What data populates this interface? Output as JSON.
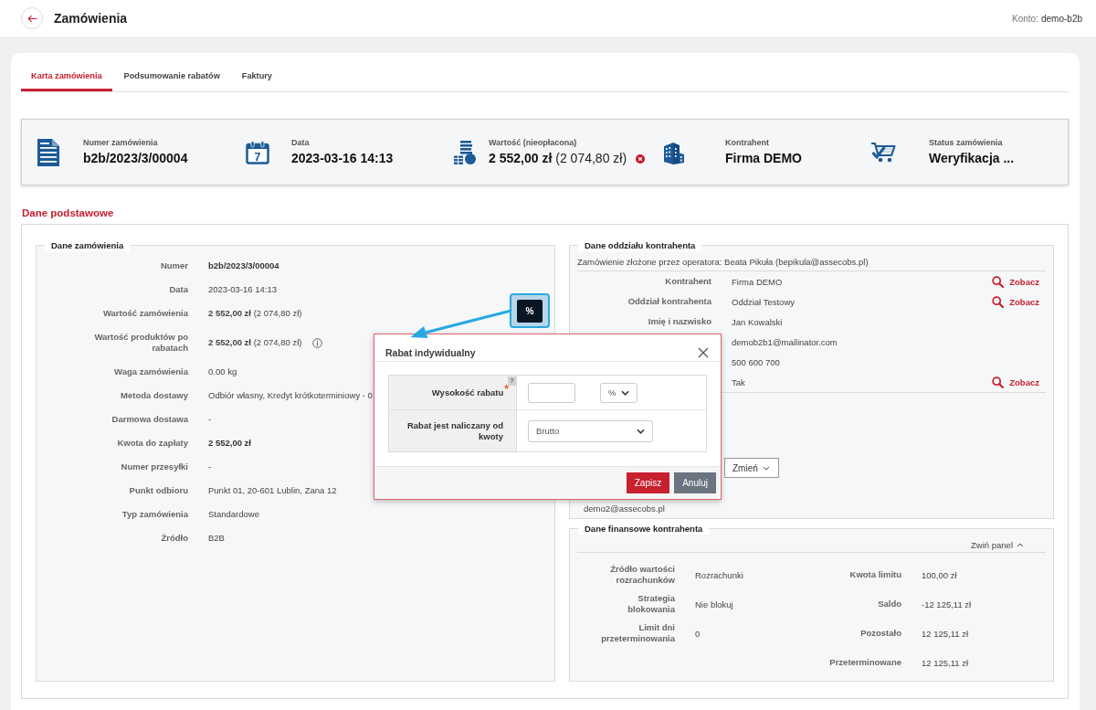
{
  "header": {
    "title": "Zamówienia",
    "account": {
      "label": "Konto:",
      "value": "demo-b2b"
    }
  },
  "tabs": [
    {
      "label": "Karta zamówienia",
      "selected": true
    },
    {
      "label": "Podsumowanie rabatów",
      "selected": false
    },
    {
      "label": "Faktury",
      "selected": false
    }
  ],
  "summary": [
    {
      "kind": "document",
      "label": "Numer zamówienia",
      "value": "b2b/2023/3/00004",
      "alert": false
    },
    {
      "kind": "calendar",
      "day": "7",
      "label": "Data",
      "value": "2023-03-16 14:13",
      "alert": false
    },
    {
      "kind": "coins",
      "label": "Wartość (nieopłacona)",
      "value": "2 552,00 zł",
      "note": "(2 074,80 zł)",
      "alert": true
    },
    {
      "kind": "building",
      "label": "Kontrahent",
      "value": "Firma DEMO",
      "alert": false
    },
    {
      "kind": "cart",
      "label": "Status zamówienia",
      "value": "Weryfikacja ...",
      "alert": false
    }
  ],
  "section_title": "Dane podstawowe",
  "order_panel": {
    "title": "Dane zamówienia",
    "rows": [
      {
        "label": "Numer",
        "value": "b2b/2023/3/00004",
        "bold": true,
        "info_icon": false
      },
      {
        "label": "Data",
        "value": "2023-03-16 14:13",
        "bold": false,
        "info_icon": false
      },
      {
        "label": "Wartość zamówienia",
        "value": "**2 552,00 zł** (2 074,80 zł)",
        "bold": false,
        "info_icon": false
      },
      {
        "label": "Wartość produktów po rabatach",
        "value": "**2 552,00 zł** (2 074,80 zł)",
        "bold": false,
        "info_icon": true
      },
      {
        "label": "Waga zamówienia",
        "value": "0.00 kg",
        "bold": false,
        "info_icon": false
      },
      {
        "label": "Metoda dostawy",
        "value": "Odbiór własny, Kredyt krótkoterminiowy - 0",
        "bold": false,
        "info_icon": false
      },
      {
        "label": "Darmowa dostawa",
        "value": "-",
        "bold": false,
        "info_icon": false
      },
      {
        "label": "Kwota do zapłaty",
        "value": "2 552,00 zł",
        "bold": true,
        "info_icon": false
      },
      {
        "label": "Numer przesyłki",
        "value": "-",
        "bold": false,
        "info_icon": false
      },
      {
        "label": "Punkt odbioru",
        "value": "Punkt 01, 20-601 Lublin, Zana 12",
        "bold": false,
        "info_icon": false
      },
      {
        "label": "Typ zamówienia",
        "value": "Standardowe",
        "bold": false,
        "info_icon": false
      },
      {
        "label": "Źródło",
        "value": "B2B",
        "bold": false,
        "info_icon": false
      }
    ]
  },
  "branch_panel": {
    "title": "Dane oddziału kontrahenta",
    "operator_note": "Zamówienie złożone przez operatora: Beata Pikuła (bepikula@assecobs.pl)",
    "rows": [
      {
        "label": "Kontrahent",
        "value": "Firma DEMO",
        "link": "Zobacz"
      },
      {
        "label": "Oddział kontrahenta",
        "value": "Oddział Testowy",
        "link": "Zobacz"
      },
      {
        "label": "Imię i nazwisko",
        "value": "Jan Kowalski"
      },
      {
        "value": "demob2b1@mailinator.com"
      },
      {
        "value": "500 600 700"
      },
      {
        "value": "Tak",
        "link": "Zobacz"
      }
    ],
    "change_button": "Zmień",
    "extra_email": "demo2@assecobs.pl"
  },
  "finance_panel": {
    "title": "Dane finansowe kontrahenta",
    "collapse": "Zwiń panel",
    "left": [
      {
        "label": "Źródło wartości rozrachunków",
        "value": "Rozrachunki"
      },
      {
        "label": "Strategia blokowania",
        "value": "Nie blokuj"
      },
      {
        "label": "Limit dni przeterminowania",
        "value": "0"
      }
    ],
    "right": [
      {
        "label": "Kwota limitu",
        "value": "100,00 zł"
      },
      {
        "label": "Saldo",
        "value": "-12 125,11 zł"
      },
      {
        "label": "Pozostało",
        "value": "12 125,11 zł"
      },
      {
        "label": "Przeterminowane",
        "value": "12 125,11 zł"
      }
    ]
  },
  "discount_button": {
    "label": "%",
    "highlighted": true
  },
  "dialog": {
    "title": "Rabat indywidualny",
    "fields": [
      {
        "kind": "amount",
        "label": "Wysokość rabatu",
        "required_mark": "*",
        "help": "?",
        "unit": "%"
      },
      {
        "kind": "select",
        "label": "Rabat jest naliczany od kwoty",
        "value": "Brutto"
      }
    ],
    "buttons": [
      {
        "kind": "primary",
        "label": "Zapisz"
      },
      {
        "kind": "secondary",
        "label": "Anuluj"
      }
    ]
  }
}
